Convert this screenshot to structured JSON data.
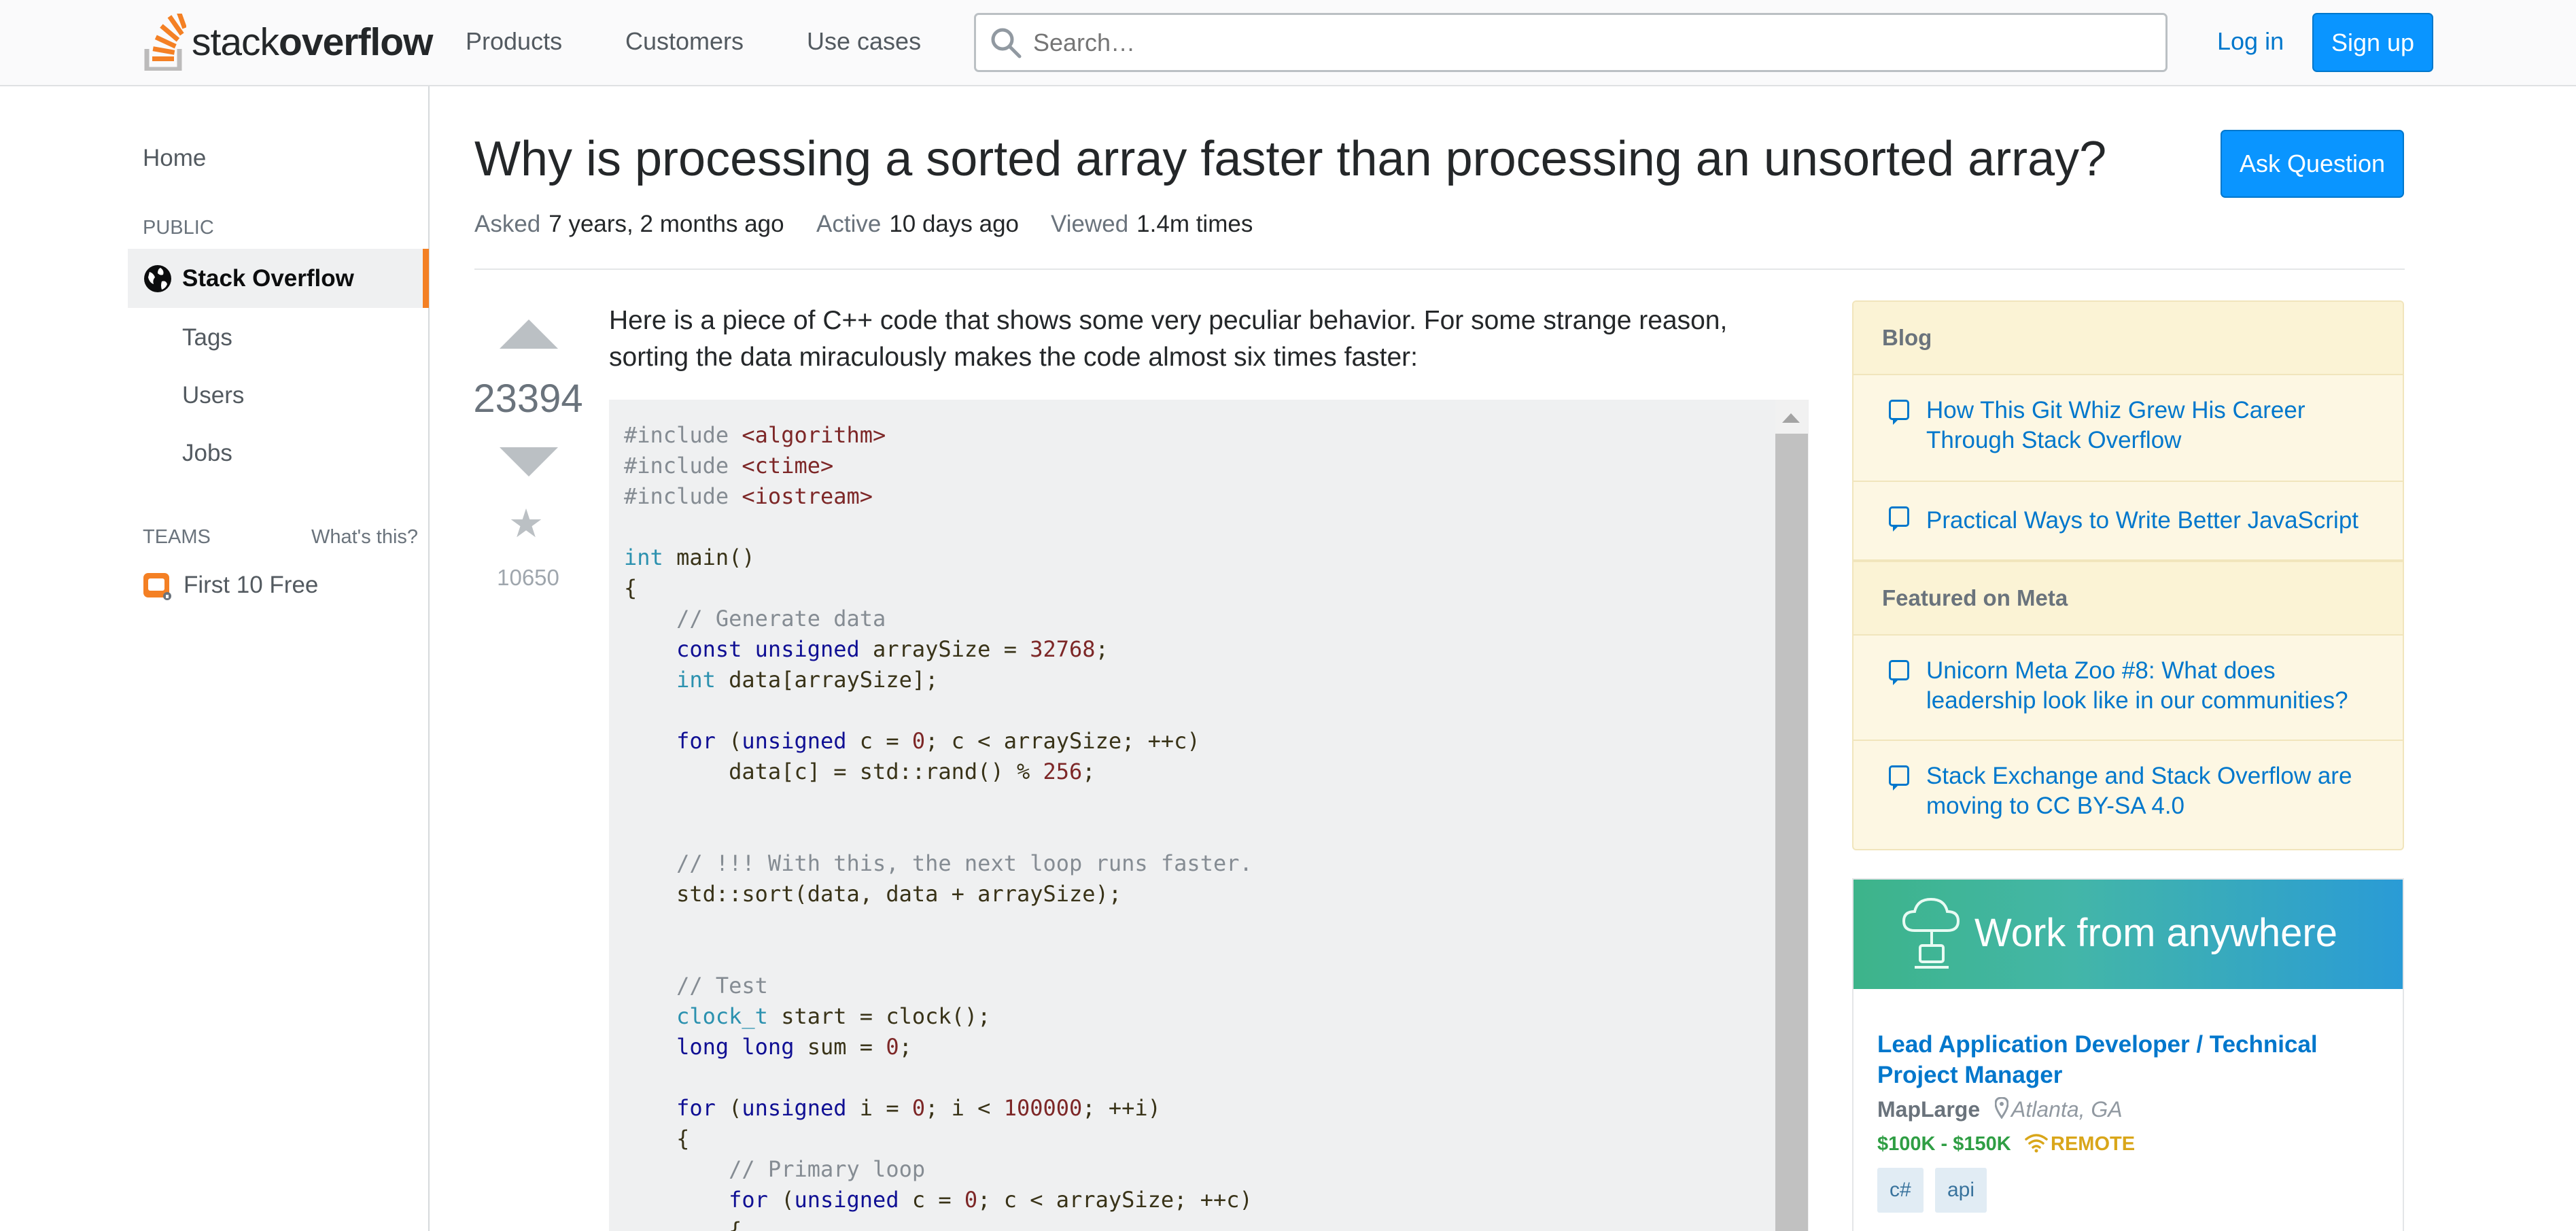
{
  "header": {
    "logo_text_light": "stack",
    "logo_text_bold": "overflow",
    "nav": [
      "Products",
      "Customers",
      "Use cases"
    ],
    "search_placeholder": "Search…",
    "login": "Log in",
    "signup": "Sign up"
  },
  "sidebar": {
    "home": "Home",
    "public_heading": "PUBLIC",
    "stack_overflow": "Stack Overflow",
    "items": [
      "Tags",
      "Users",
      "Jobs"
    ],
    "teams_heading": "TEAMS",
    "whats_this": "What's this?",
    "teams_free": "First 10 Free"
  },
  "question": {
    "title": "Why is processing a sorted array faster than processing an unsorted array?",
    "ask_button": "Ask Question",
    "asked_label": "Asked",
    "asked_value": "7 years, 2 months ago",
    "active_label": "Active",
    "active_value": "10 days ago",
    "viewed_label": "Viewed",
    "viewed_value": "1.4m times",
    "votes": "23394",
    "favorites": "10650",
    "body": "Here is a piece of C++ code that shows some very peculiar behavior. For some strange reason, sorting the data miraculously makes the code almost six times faster:"
  },
  "code": {
    "lines": [
      [
        [
          "pre",
          "#include "
        ],
        [
          "str",
          "<algorithm>"
        ]
      ],
      [
        [
          "pre",
          "#include "
        ],
        [
          "str",
          "<ctime>"
        ]
      ],
      [
        [
          "pre",
          "#include "
        ],
        [
          "str",
          "<iostream>"
        ]
      ],
      [],
      [
        [
          "ty",
          "int"
        ],
        [
          "pl",
          " main()"
        ]
      ],
      [
        [
          "pl",
          "{"
        ]
      ],
      [
        [
          "pl",
          "    "
        ],
        [
          "com",
          "// Generate data"
        ]
      ],
      [
        [
          "pl",
          "    "
        ],
        [
          "kw",
          "const"
        ],
        [
          "pl",
          " "
        ],
        [
          "kw",
          "unsigned"
        ],
        [
          "pl",
          " arraySize = "
        ],
        [
          "num",
          "32768"
        ],
        [
          "pl",
          ";"
        ]
      ],
      [
        [
          "pl",
          "    "
        ],
        [
          "ty",
          "int"
        ],
        [
          "pl",
          " data[arraySize];"
        ]
      ],
      [],
      [
        [
          "pl",
          "    "
        ],
        [
          "kw",
          "for"
        ],
        [
          "pl",
          " ("
        ],
        [
          "kw",
          "unsigned"
        ],
        [
          "pl",
          " c = "
        ],
        [
          "num",
          "0"
        ],
        [
          "pl",
          "; c < arraySize; ++c)"
        ]
      ],
      [
        [
          "pl",
          "        data[c] = std::rand() % "
        ],
        [
          "num",
          "256"
        ],
        [
          "pl",
          ";"
        ]
      ],
      [],
      [],
      [
        [
          "pl",
          "    "
        ],
        [
          "com",
          "// !!! With this, the next loop runs faster."
        ]
      ],
      [
        [
          "pl",
          "    std::sort(data, data + arraySize);"
        ]
      ],
      [],
      [],
      [
        [
          "pl",
          "    "
        ],
        [
          "com",
          "// Test"
        ]
      ],
      [
        [
          "pl",
          "    "
        ],
        [
          "ty",
          "clock_t"
        ],
        [
          "pl",
          " start = clock();"
        ]
      ],
      [
        [
          "pl",
          "    "
        ],
        [
          "kw",
          "long"
        ],
        [
          "pl",
          " "
        ],
        [
          "kw",
          "long"
        ],
        [
          "pl",
          " sum = "
        ],
        [
          "num",
          "0"
        ],
        [
          "pl",
          ";"
        ]
      ],
      [],
      [
        [
          "pl",
          "    "
        ],
        [
          "kw",
          "for"
        ],
        [
          "pl",
          " ("
        ],
        [
          "kw",
          "unsigned"
        ],
        [
          "pl",
          " i = "
        ],
        [
          "num",
          "0"
        ],
        [
          "pl",
          "; i < "
        ],
        [
          "num",
          "100000"
        ],
        [
          "pl",
          "; ++i)"
        ]
      ],
      [
        [
          "pl",
          "    {"
        ]
      ],
      [
        [
          "pl",
          "        "
        ],
        [
          "com",
          "// Primary loop"
        ]
      ],
      [
        [
          "pl",
          "        "
        ],
        [
          "kw",
          "for"
        ],
        [
          "pl",
          " ("
        ],
        [
          "kw",
          "unsigned"
        ],
        [
          "pl",
          " c = "
        ],
        [
          "num",
          "0"
        ],
        [
          "pl",
          "; c < arraySize; ++c)"
        ]
      ],
      [
        [
          "pl",
          "        {"
        ]
      ]
    ]
  },
  "blog_widget": {
    "blog_heading": "Blog",
    "blog_items": [
      "How This Git Whiz Grew His Career Through Stack Overflow",
      "Practical Ways to Write Better JavaScript"
    ],
    "meta_heading": "Featured on Meta",
    "meta_items": [
      "Unicorn Meta Zoo #8: What does leadership look like in our communities?",
      "Stack Exchange and Stack Overflow are moving to CC BY-SA 4.0"
    ]
  },
  "job_ad": {
    "banner": "Work from anywhere",
    "title": "Lead Application Developer / Technical Project Manager",
    "company": "MapLarge",
    "location": "Atlanta, GA",
    "salary": "$100K - $150K",
    "remote": "REMOTE",
    "tags": [
      "c#",
      "api"
    ]
  },
  "colors": {
    "accent": "#0a95ff",
    "brand_orange": "#f48024",
    "link": "#0077cc",
    "widget_bg": "#fdf7e3"
  }
}
